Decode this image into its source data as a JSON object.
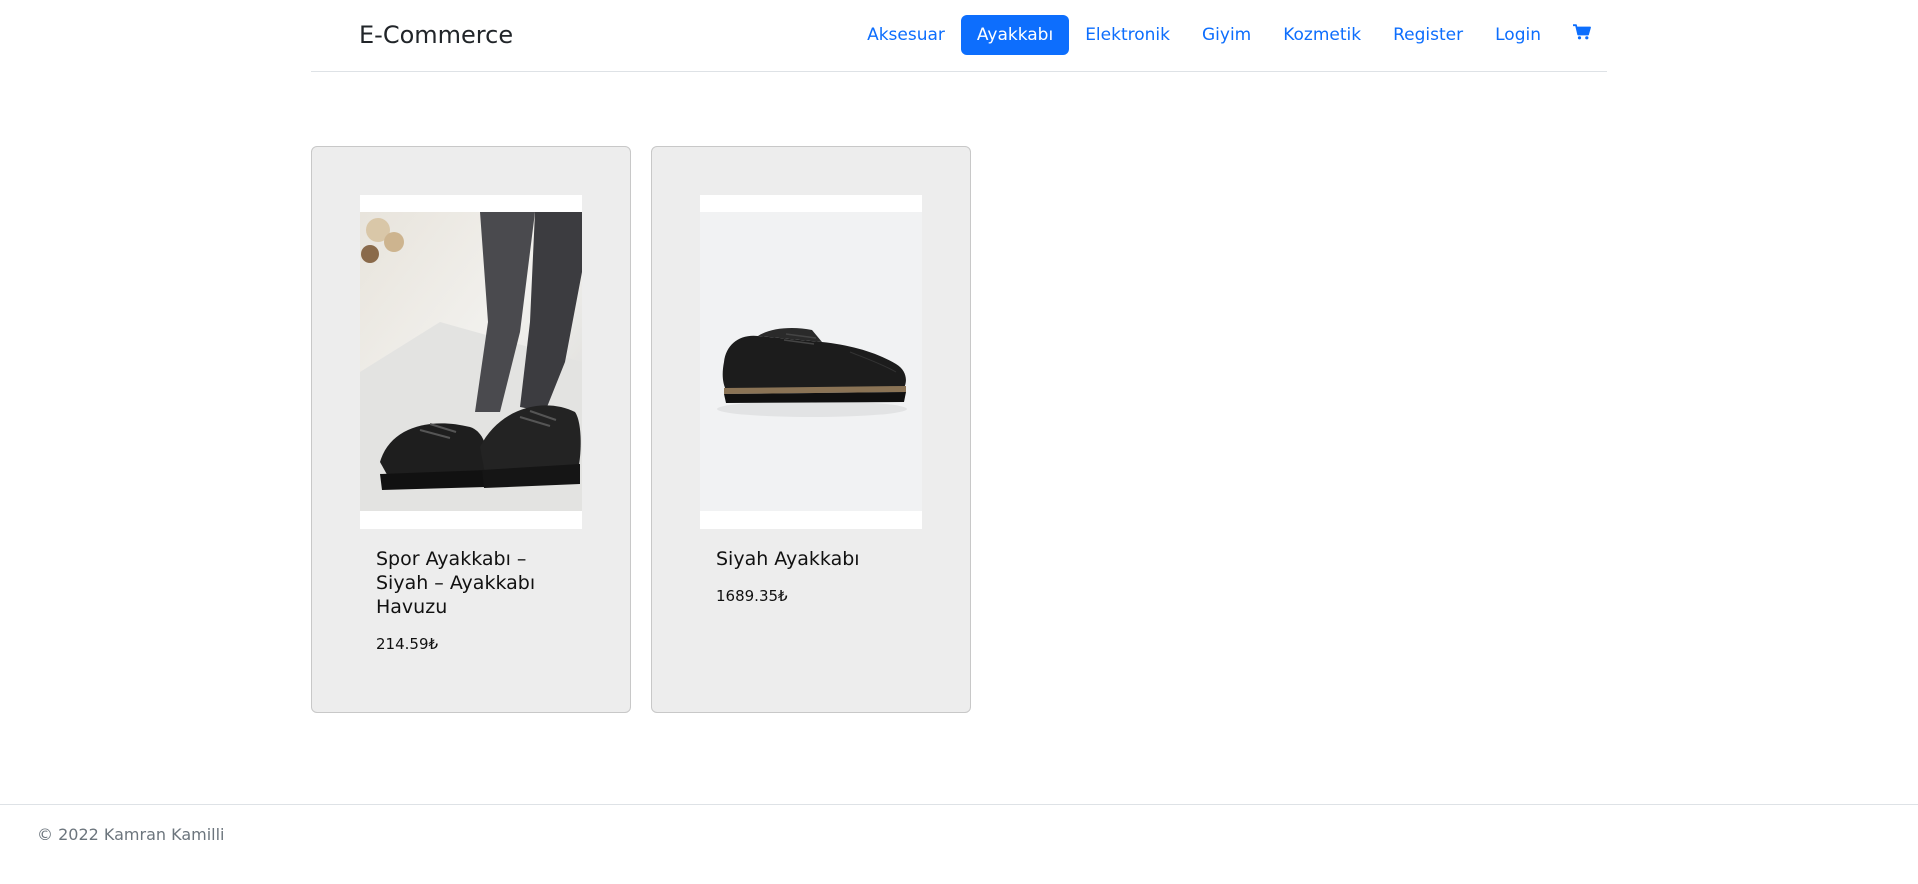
{
  "navbar": {
    "brand": "E-Commerce",
    "links": [
      {
        "label": "Aksesuar",
        "active": false
      },
      {
        "label": "Ayakkabı",
        "active": true
      },
      {
        "label": "Elektronik",
        "active": false
      },
      {
        "label": "Giyim",
        "active": false
      },
      {
        "label": "Kozmetik",
        "active": false
      },
      {
        "label": "Register",
        "active": false
      },
      {
        "label": "Login",
        "active": false
      }
    ],
    "cart_icon": "cart-icon",
    "accent_color": "#0d6efd"
  },
  "products": [
    {
      "title": "Spor Ayakkabı – Siyah – Ayakkabı Havuzu",
      "price": "214.59₺",
      "image": "sneaker-photo"
    },
    {
      "title": "Siyah Ayakkabı",
      "price": "1689.35₺",
      "image": "oxford-shoe-photo"
    }
  ],
  "footer": {
    "text": "© 2022 Kamran Kamilli"
  }
}
